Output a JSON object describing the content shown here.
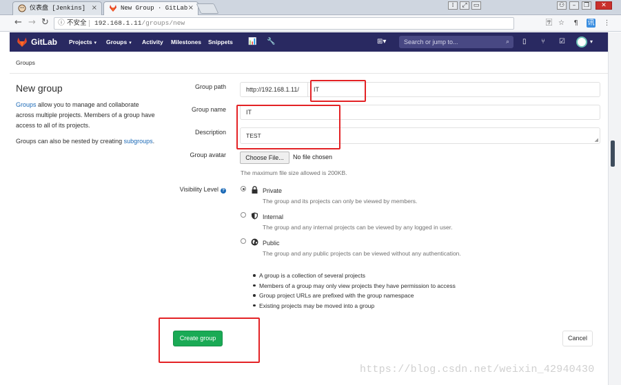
{
  "browser": {
    "tabs": [
      {
        "title": "仪表盘 [Jenkins]",
        "close": "×",
        "active": false
      },
      {
        "title": "New Group · GitLab",
        "close": "×",
        "active": true
      }
    ],
    "security_label": "不安全",
    "url_host": "192.168.1.11",
    "url_path": "/groups/new"
  },
  "gitlab_header": {
    "brand": "GitLab",
    "nav": [
      {
        "label": "Projects",
        "dropdown": true
      },
      {
        "label": "Groups",
        "dropdown": true
      },
      {
        "label": "Activity",
        "dropdown": false
      },
      {
        "label": "Milestones",
        "dropdown": false
      },
      {
        "label": "Snippets",
        "dropdown": false
      }
    ],
    "search_placeholder": "Search or jump to..."
  },
  "breadcrumb": "Groups",
  "sidebar": {
    "title": "New group",
    "desc_link": "Groups",
    "desc_rest": " allow you to manage and collaborate across multiple projects. Members of a group have access to all of its projects.",
    "nested_text": "Groups can also be nested by creating ",
    "nested_link": "subgroups",
    "nested_end": "."
  },
  "form": {
    "group_path_label": "Group path",
    "group_path_prefix": "http://192.168.1.11/",
    "group_path_value": "IT",
    "group_name_label": "Group name",
    "group_name_value": "IT",
    "description_label": "Description",
    "description_value": "TEST",
    "avatar_label": "Group avatar",
    "choose_file": "Choose File",
    "no_file": "No file chosen",
    "max_size": "The maximum file size allowed is 200KB.",
    "visibility_label": "Visibility Level",
    "visibility_options": [
      {
        "name": "Private",
        "desc": "The group and its projects can only be viewed by members.",
        "selected": true,
        "icon": "lock-icon"
      },
      {
        "name": "Internal",
        "desc": "The group and any internal projects can be viewed by any logged in user.",
        "selected": false,
        "icon": "shield-icon"
      },
      {
        "name": "Public",
        "desc": "The group and any public projects can be viewed without any authentication.",
        "selected": false,
        "icon": "globe-icon"
      }
    ],
    "notes": [
      "A group is a collection of several projects",
      "Members of a group may only view projects they have permission to access",
      "Group project URLs are prefixed with the group namespace",
      "Existing projects may be moved into a group"
    ],
    "create_button": "Create group",
    "cancel_button": "Cancel"
  },
  "watermark": "https://blog.csdn.net/weixin_42940430",
  "colors": {
    "header_bg": "#292961",
    "create_btn": "#1aaa55",
    "link": "#1b69b6",
    "highlight_box": "#e32124"
  }
}
